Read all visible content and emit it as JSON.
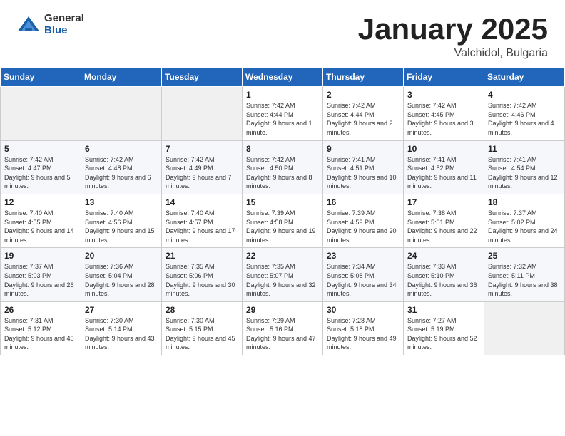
{
  "header": {
    "logo_general": "General",
    "logo_blue": "Blue",
    "month_title": "January 2025",
    "subtitle": "Valchidol, Bulgaria"
  },
  "weekdays": [
    "Sunday",
    "Monday",
    "Tuesday",
    "Wednesday",
    "Thursday",
    "Friday",
    "Saturday"
  ],
  "weeks": [
    [
      {
        "day": "",
        "info": ""
      },
      {
        "day": "",
        "info": ""
      },
      {
        "day": "",
        "info": ""
      },
      {
        "day": "1",
        "info": "Sunrise: 7:42 AM\nSunset: 4:44 PM\nDaylight: 9 hours and 1 minute."
      },
      {
        "day": "2",
        "info": "Sunrise: 7:42 AM\nSunset: 4:44 PM\nDaylight: 9 hours and 2 minutes."
      },
      {
        "day": "3",
        "info": "Sunrise: 7:42 AM\nSunset: 4:45 PM\nDaylight: 9 hours and 3 minutes."
      },
      {
        "day": "4",
        "info": "Sunrise: 7:42 AM\nSunset: 4:46 PM\nDaylight: 9 hours and 4 minutes."
      }
    ],
    [
      {
        "day": "5",
        "info": "Sunrise: 7:42 AM\nSunset: 4:47 PM\nDaylight: 9 hours and 5 minutes."
      },
      {
        "day": "6",
        "info": "Sunrise: 7:42 AM\nSunset: 4:48 PM\nDaylight: 9 hours and 6 minutes."
      },
      {
        "day": "7",
        "info": "Sunrise: 7:42 AM\nSunset: 4:49 PM\nDaylight: 9 hours and 7 minutes."
      },
      {
        "day": "8",
        "info": "Sunrise: 7:42 AM\nSunset: 4:50 PM\nDaylight: 9 hours and 8 minutes."
      },
      {
        "day": "9",
        "info": "Sunrise: 7:41 AM\nSunset: 4:51 PM\nDaylight: 9 hours and 10 minutes."
      },
      {
        "day": "10",
        "info": "Sunrise: 7:41 AM\nSunset: 4:52 PM\nDaylight: 9 hours and 11 minutes."
      },
      {
        "day": "11",
        "info": "Sunrise: 7:41 AM\nSunset: 4:54 PM\nDaylight: 9 hours and 12 minutes."
      }
    ],
    [
      {
        "day": "12",
        "info": "Sunrise: 7:40 AM\nSunset: 4:55 PM\nDaylight: 9 hours and 14 minutes."
      },
      {
        "day": "13",
        "info": "Sunrise: 7:40 AM\nSunset: 4:56 PM\nDaylight: 9 hours and 15 minutes."
      },
      {
        "day": "14",
        "info": "Sunrise: 7:40 AM\nSunset: 4:57 PM\nDaylight: 9 hours and 17 minutes."
      },
      {
        "day": "15",
        "info": "Sunrise: 7:39 AM\nSunset: 4:58 PM\nDaylight: 9 hours and 19 minutes."
      },
      {
        "day": "16",
        "info": "Sunrise: 7:39 AM\nSunset: 4:59 PM\nDaylight: 9 hours and 20 minutes."
      },
      {
        "day": "17",
        "info": "Sunrise: 7:38 AM\nSunset: 5:01 PM\nDaylight: 9 hours and 22 minutes."
      },
      {
        "day": "18",
        "info": "Sunrise: 7:37 AM\nSunset: 5:02 PM\nDaylight: 9 hours and 24 minutes."
      }
    ],
    [
      {
        "day": "19",
        "info": "Sunrise: 7:37 AM\nSunset: 5:03 PM\nDaylight: 9 hours and 26 minutes."
      },
      {
        "day": "20",
        "info": "Sunrise: 7:36 AM\nSunset: 5:04 PM\nDaylight: 9 hours and 28 minutes."
      },
      {
        "day": "21",
        "info": "Sunrise: 7:35 AM\nSunset: 5:06 PM\nDaylight: 9 hours and 30 minutes."
      },
      {
        "day": "22",
        "info": "Sunrise: 7:35 AM\nSunset: 5:07 PM\nDaylight: 9 hours and 32 minutes."
      },
      {
        "day": "23",
        "info": "Sunrise: 7:34 AM\nSunset: 5:08 PM\nDaylight: 9 hours and 34 minutes."
      },
      {
        "day": "24",
        "info": "Sunrise: 7:33 AM\nSunset: 5:10 PM\nDaylight: 9 hours and 36 minutes."
      },
      {
        "day": "25",
        "info": "Sunrise: 7:32 AM\nSunset: 5:11 PM\nDaylight: 9 hours and 38 minutes."
      }
    ],
    [
      {
        "day": "26",
        "info": "Sunrise: 7:31 AM\nSunset: 5:12 PM\nDaylight: 9 hours and 40 minutes."
      },
      {
        "day": "27",
        "info": "Sunrise: 7:30 AM\nSunset: 5:14 PM\nDaylight: 9 hours and 43 minutes."
      },
      {
        "day": "28",
        "info": "Sunrise: 7:30 AM\nSunset: 5:15 PM\nDaylight: 9 hours and 45 minutes."
      },
      {
        "day": "29",
        "info": "Sunrise: 7:29 AM\nSunset: 5:16 PM\nDaylight: 9 hours and 47 minutes."
      },
      {
        "day": "30",
        "info": "Sunrise: 7:28 AM\nSunset: 5:18 PM\nDaylight: 9 hours and 49 minutes."
      },
      {
        "day": "31",
        "info": "Sunrise: 7:27 AM\nSunset: 5:19 PM\nDaylight: 9 hours and 52 minutes."
      },
      {
        "day": "",
        "info": ""
      }
    ]
  ]
}
